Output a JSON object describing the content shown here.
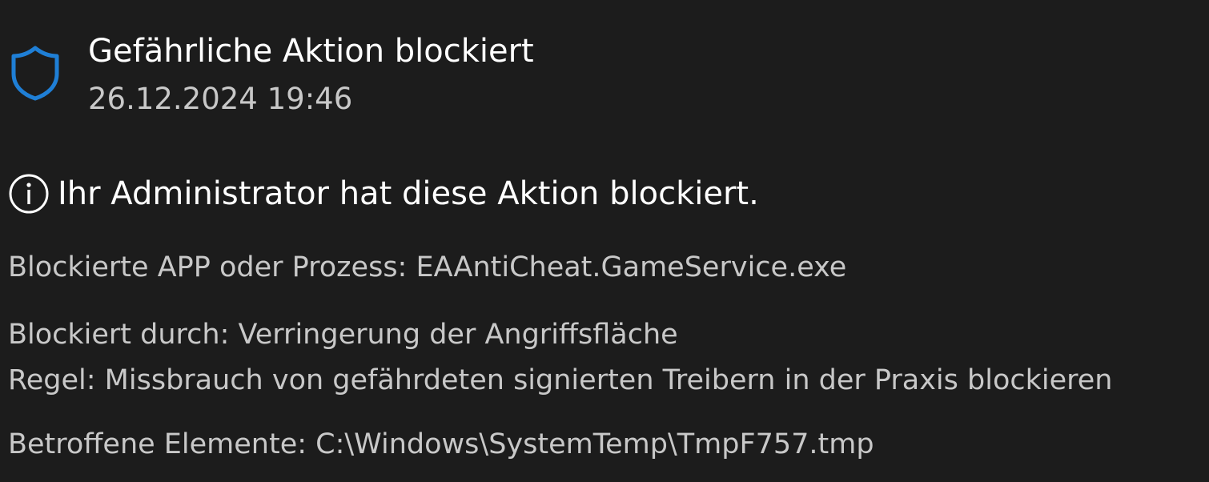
{
  "notification": {
    "icon": "shield-icon",
    "accent_color": "#1f7fd6",
    "title": "Gefährliche Aktion blockiert",
    "timestamp": "26.12.2024 19:46"
  },
  "message": {
    "icon": "info-icon",
    "text": "Ihr Administrator hat diese Aktion blockiert."
  },
  "details": {
    "blocked_app": "Blockierte APP oder Prozess: EAAntiCheat.GameService.exe",
    "blocked_by": "Blockiert durch: Verringerung der Angriffsfläche",
    "rule": "Regel: Missbrauch von gefährdeten signierten Treibern in der Praxis blockieren",
    "affected_items": "Betroffene Elemente: C:\\Windows\\SystemTemp\\TmpF757.tmp"
  }
}
